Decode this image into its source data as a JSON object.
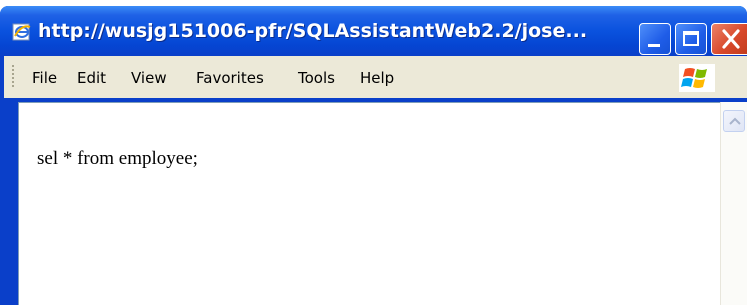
{
  "window": {
    "title": "http://wusjg151006-pfr/SQLAssistantWeb2.2/jose..."
  },
  "controls": {
    "minimize": "minimize",
    "maximize": "maximize",
    "close": "close"
  },
  "menubar": {
    "items": [
      "File",
      "Edit",
      "View",
      "Favorites",
      "Tools",
      "Help"
    ]
  },
  "content": {
    "text": "sel * from employee;"
  },
  "icons": {
    "title": "ie-page-icon",
    "logo": "windows-logo-icon",
    "scroll_up": "scroll-up-arrow-icon"
  },
  "colors": {
    "titlebar": "#0a52de",
    "close_button": "#d8482a",
    "menubar": "#ece9d8"
  }
}
